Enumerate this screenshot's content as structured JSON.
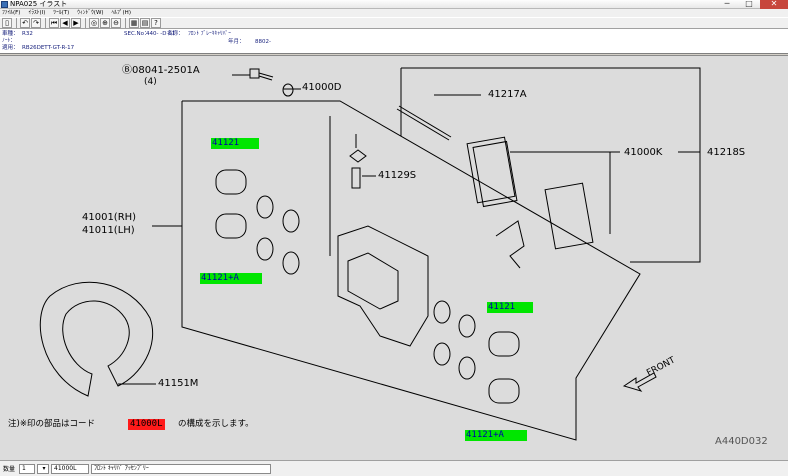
{
  "window": {
    "title": "NPA025 イラスト",
    "minimize": "─",
    "maximize": "□",
    "close": "✕"
  },
  "menu": [
    "ﾌｧｲﾙ(F)",
    "ｲﾗｽﾄ(I)",
    "ﾂｰﾙ(T)",
    "ｳｨﾝﾄﾞｳ(W)",
    "ﾍﾙﾌﾟ(H)"
  ],
  "toolbar": {
    "icons": [
      "file-icon",
      "back-icon",
      "forward-icon",
      "first-icon",
      "prev-icon",
      "next-icon",
      "zoom-fit-icon",
      "zoom-in-icon",
      "zoom-out-icon",
      "grid-icon",
      "print-icon",
      "help-icon"
    ],
    "glyphs": [
      "▯",
      "↶",
      "↷",
      "⏮",
      "◀",
      "▶",
      "◎",
      "⊕",
      "⊖",
      "▦",
      "▤",
      "?"
    ]
  },
  "info": {
    "model_label": "車種：",
    "model_value": "R32",
    "note_label": "ﾉｰﾄ：",
    "applies_label": "適用：",
    "applies_value": "RB26DETT-GT-R-17",
    "sec_label": "SEC.No：",
    "sec_value": "440- -D 01",
    "name_label": "名称：",
    "name_value": "ﾌﾛﾝﾄ ﾌﾞﾚｰｷｷｬﾘﾊﾟｰ",
    "year_label": "年月：",
    "year_value": "8802-"
  },
  "diagram": {
    "labels": {
      "bolt": "Ⓑ08041-2501A",
      "bolt_qty": "(4)",
      "p41000D": "41000D",
      "p41217A": "41217A",
      "p41000K": "41000K",
      "p41218S": "41218S",
      "p41129S": "41129S",
      "p41001": "41001(RH)",
      "p41011": "41011(LH)",
      "p41151M": "41151M",
      "front": "FRONT",
      "code": "A440D032"
    },
    "tags": {
      "t1": "41121",
      "t2": "41121+A",
      "t3": "41121",
      "t4": "41121+A"
    },
    "note_prefix": "注)※印の部品はコード",
    "note_code": "41000L",
    "note_suffix": "の構成を示します。"
  },
  "status": {
    "qty_label": "数量",
    "qty_value": "1",
    "part_value": "41000L",
    "desc_value": "ﾌﾛﾝﾄ ｷｬﾘﾊﾟ ｱｯｾﾝﾌﾞﾘｰ"
  }
}
